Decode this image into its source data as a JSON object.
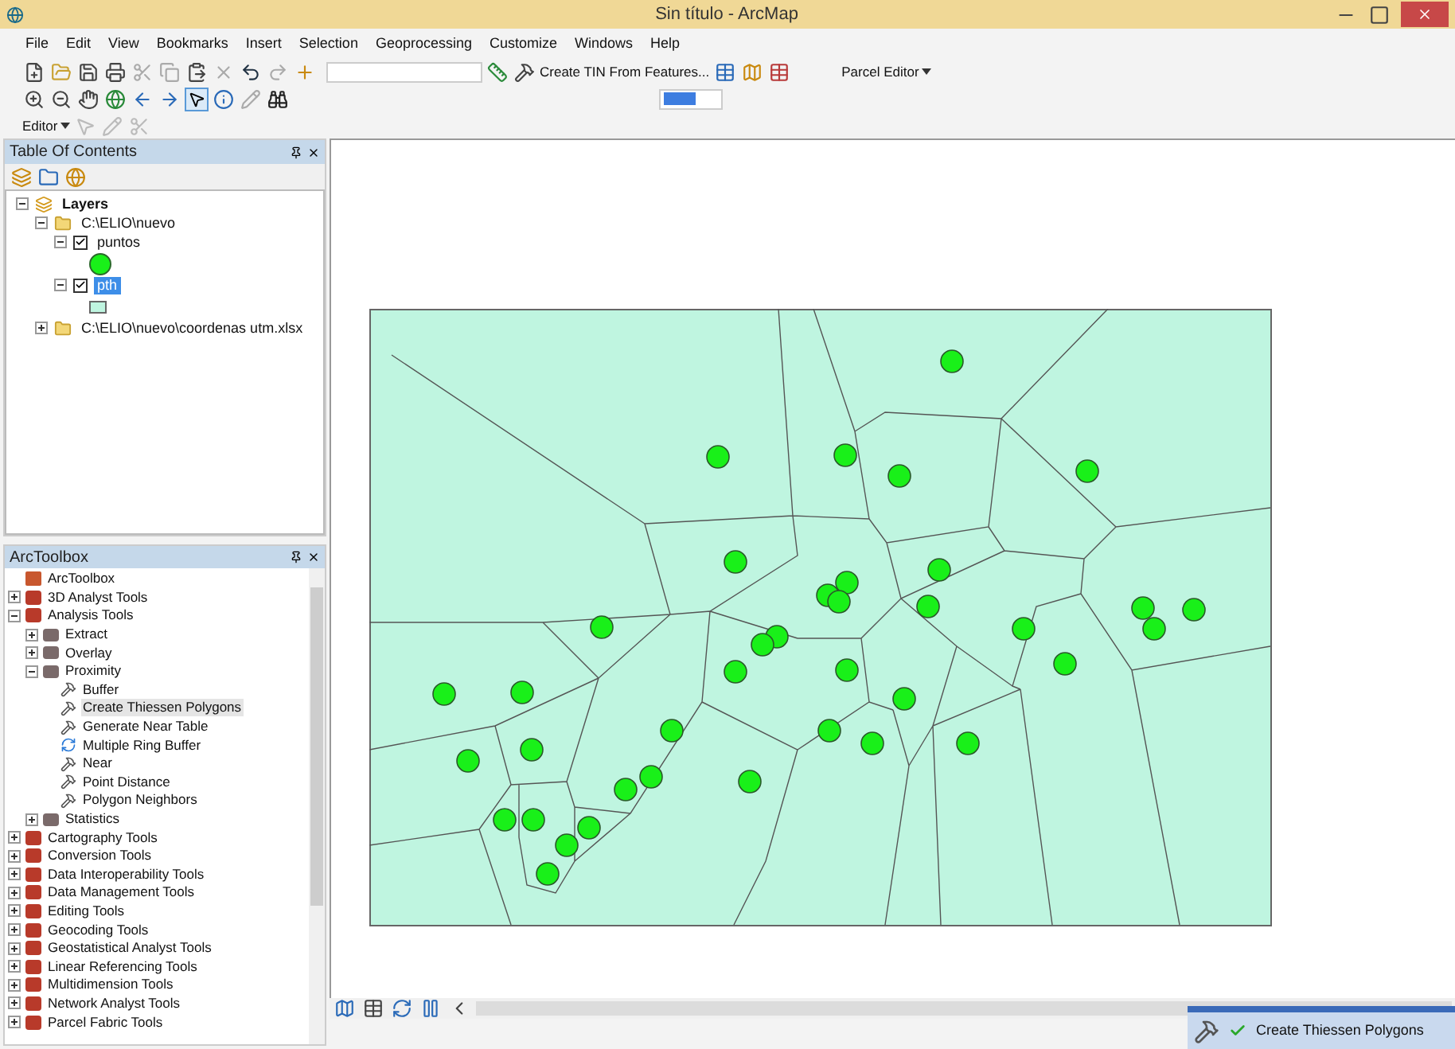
{
  "window": {
    "title": "Sin título - ArcMap"
  },
  "menu": [
    "File",
    "Edit",
    "View",
    "Bookmarks",
    "Insert",
    "Selection",
    "Geoprocessing",
    "Customize",
    "Windows",
    "Help"
  ],
  "toolbar": {
    "tin_tool": "Create TIN From Features...",
    "parcel_editor": "Parcel Editor",
    "editor": "Editor"
  },
  "toc": {
    "title": "Table Of Contents",
    "tree": [
      {
        "label": "Layers",
        "kind": "frame",
        "expanded": true,
        "children": [
          {
            "label": "C:\\ELIO\\nuevo",
            "kind": "folder",
            "expanded": true,
            "children": [
              {
                "label": "puntos",
                "kind": "layer",
                "checked": true,
                "expanded": true,
                "selected": false,
                "children": [
                  {
                    "kind": "point_symbol"
                  }
                ]
              },
              {
                "label": "pth",
                "kind": "layer",
                "checked": true,
                "expanded": true,
                "selected": true,
                "children": [
                  {
                    "kind": "polygon_symbol"
                  }
                ]
              }
            ]
          },
          {
            "label": "C:\\ELIO\\nuevo\\coordenas utm.xlsx",
            "kind": "folder",
            "expanded": false
          }
        ]
      }
    ]
  },
  "toolbox": {
    "title": "ArcToolbox",
    "tree": [
      {
        "label": "ArcToolbox",
        "kind": "root",
        "children": [
          {
            "label": "3D Analyst Tools",
            "kind": "toolbox",
            "expanded": false
          },
          {
            "label": "Analysis Tools",
            "kind": "toolbox",
            "expanded": true,
            "children": [
              {
                "label": "Extract",
                "kind": "toolset",
                "expanded": false
              },
              {
                "label": "Overlay",
                "kind": "toolset",
                "expanded": false
              },
              {
                "label": "Proximity",
                "kind": "toolset",
                "expanded": true,
                "children": [
                  {
                    "label": "Buffer",
                    "kind": "tool",
                    "selected": false
                  },
                  {
                    "label": "Create Thiessen Polygons",
                    "kind": "tool",
                    "selected": true
                  },
                  {
                    "label": "Generate Near Table",
                    "kind": "tool",
                    "selected": false
                  },
                  {
                    "label": "Multiple Ring Buffer",
                    "kind": "script",
                    "selected": false
                  },
                  {
                    "label": "Near",
                    "kind": "tool",
                    "selected": false
                  },
                  {
                    "label": "Point Distance",
                    "kind": "tool",
                    "selected": false
                  },
                  {
                    "label": "Polygon Neighbors",
                    "kind": "tool",
                    "selected": false
                  }
                ]
              },
              {
                "label": "Statistics",
                "kind": "toolset",
                "expanded": false
              }
            ]
          },
          {
            "label": "Cartography Tools",
            "kind": "toolbox",
            "expanded": false
          },
          {
            "label": "Conversion Tools",
            "kind": "toolbox",
            "expanded": false
          },
          {
            "label": "Data Interoperability Tools",
            "kind": "toolbox",
            "expanded": false
          },
          {
            "label": "Data Management Tools",
            "kind": "toolbox",
            "expanded": false
          },
          {
            "label": "Editing Tools",
            "kind": "toolbox",
            "expanded": false
          },
          {
            "label": "Geocoding Tools",
            "kind": "toolbox",
            "expanded": false
          },
          {
            "label": "Geostatistical Analyst Tools",
            "kind": "toolbox",
            "expanded": false
          },
          {
            "label": "Linear Referencing Tools",
            "kind": "toolbox",
            "expanded": false
          },
          {
            "label": "Multidimension Tools",
            "kind": "toolbox",
            "expanded": false
          },
          {
            "label": "Network Analyst Tools",
            "kind": "toolbox",
            "expanded": false
          },
          {
            "label": "Parcel Fabric Tools",
            "kind": "toolbox",
            "expanded": false
          }
        ]
      }
    ]
  },
  "notification": {
    "title": "Create Thiessen Polygons",
    "succeeded": true
  }
}
